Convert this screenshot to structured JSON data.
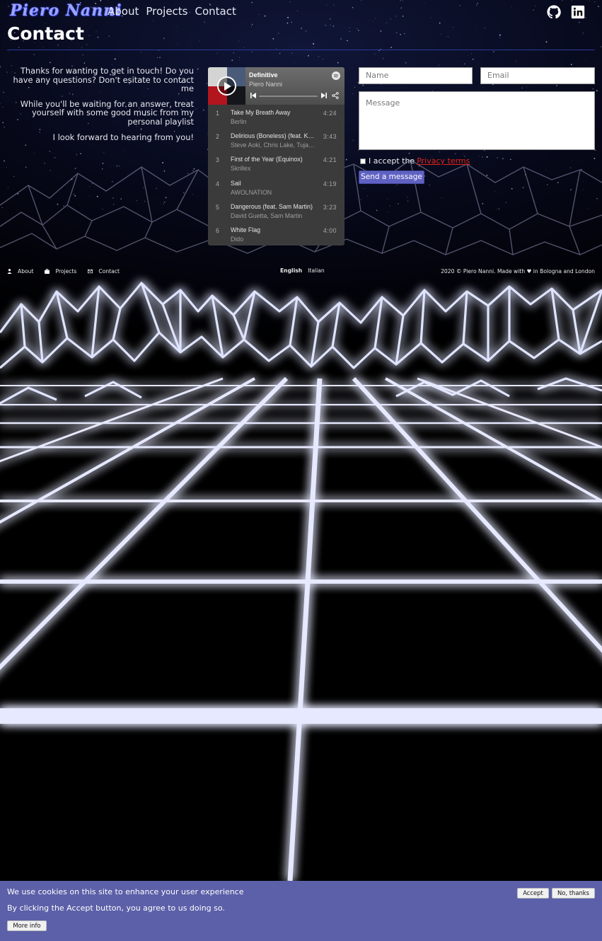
{
  "header": {
    "logo": "Piero Nanni",
    "nav": [
      "About",
      "Projects",
      "Contact"
    ],
    "social": [
      "github-icon",
      "linkedin-icon"
    ]
  },
  "page": {
    "title": "Contact",
    "intro": [
      "Thanks for wanting to get in touch! Do you have any questions? Don't esitate to contact me",
      "While you'll be waiting for an answer, treat yourself with some good music from my personal playlist",
      "I look forward to hearing from you!"
    ]
  },
  "player": {
    "playlist_title": "Definitive",
    "owner": "Piero Nanni",
    "progress": 0,
    "tracks": [
      {
        "num": "1",
        "name": "Take My Breath Away",
        "artist": "Berlin",
        "duration": "4:24"
      },
      {
        "num": "2",
        "name": "Delirious (Boneless) (feat. Kid Ink)",
        "artist": "Steve Aoki, Chris Lake, Tujamo",
        "duration": "3:43"
      },
      {
        "num": "3",
        "name": "First of the Year (Equinox)",
        "artist": "Skrillex",
        "duration": "4:21"
      },
      {
        "num": "4",
        "name": "Sail",
        "artist": "AWOLNATION",
        "duration": "4:19"
      },
      {
        "num": "5",
        "name": "Dangerous (feat. Sam Martin)",
        "artist": "David Guetta, Sam Martin",
        "duration": "3:23"
      },
      {
        "num": "6",
        "name": "White Flag",
        "artist": "Dido",
        "duration": "4:00"
      }
    ]
  },
  "form": {
    "name_placeholder": "Name",
    "email_placeholder": "Email",
    "message_placeholder": "Message",
    "consent_text": "I accept the",
    "consent_link": "Privacy terms",
    "submit": "Send a message"
  },
  "footer": {
    "nav": [
      "About",
      "Projects",
      "Contact"
    ],
    "languages": [
      "English",
      "Italian"
    ],
    "active_language": "English",
    "copyright": "2020 © Piero Nanni. Made with ♥ in Bologna and London"
  },
  "cookie": {
    "title": "We use cookies on this site to enhance your user experience",
    "subtitle": "By clicking the Accept button, you agree to us doing so.",
    "more_info": "More info",
    "accept": "Accept",
    "decline": "No, thanks"
  },
  "colors": {
    "accent": "#6062c2",
    "grid_glow": "#2a2cff",
    "cookie_bar": "#5b60a8",
    "link_red": "#e0231c"
  }
}
